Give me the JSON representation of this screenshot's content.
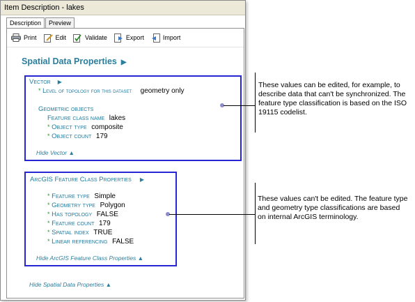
{
  "window": {
    "title": "Item Description - lakes"
  },
  "tabs": [
    "Description",
    "Preview"
  ],
  "toolbar": {
    "print": "Print",
    "edit": "Edit",
    "validate": "Validate",
    "export": "Export",
    "import": "Import"
  },
  "heading": "Spatial Data Properties",
  "vector": {
    "title": "Vector",
    "topology_label": "Level of topology for this dataset",
    "topology_value": "geometry only",
    "geometric_objects": "Geometric objects",
    "class_label": "Feature class name",
    "class_value": "lakes",
    "type_label": "Object type",
    "type_value": "composite",
    "count_label": "Object count",
    "count_value": "179",
    "hide_link": "Hide Vector ▲"
  },
  "arcgis": {
    "title": "ArcGIS Feature Class Properties",
    "props": [
      {
        "label": "Feature type",
        "value": "Simple"
      },
      {
        "label": "Geometry type",
        "value": "Polygon"
      },
      {
        "label": "Has topology",
        "value": "FALSE"
      },
      {
        "label": "Feature count",
        "value": "179"
      },
      {
        "label": "Spatial index",
        "value": "TRUE"
      },
      {
        "label": "Linear referencing",
        "value": "FALSE"
      }
    ],
    "hide_link": "Hide ArcGIS Feature Class Properties ▲"
  },
  "hide_spatial": "Hide Spatial Data Properties ▲",
  "callouts": {
    "editable": "These values can be edited, for example, to describe data that can't be synchronized. The feature type classification is based on the ISO 19115 codelist.",
    "readonly": "These values can't be edited. The feature type and geometry type classifications are based on internal ArcGIS terminology."
  },
  "colors": {
    "accent": "#2a7f9e",
    "box_border": "#2626d4",
    "asterisk": "#2b9a2b"
  }
}
